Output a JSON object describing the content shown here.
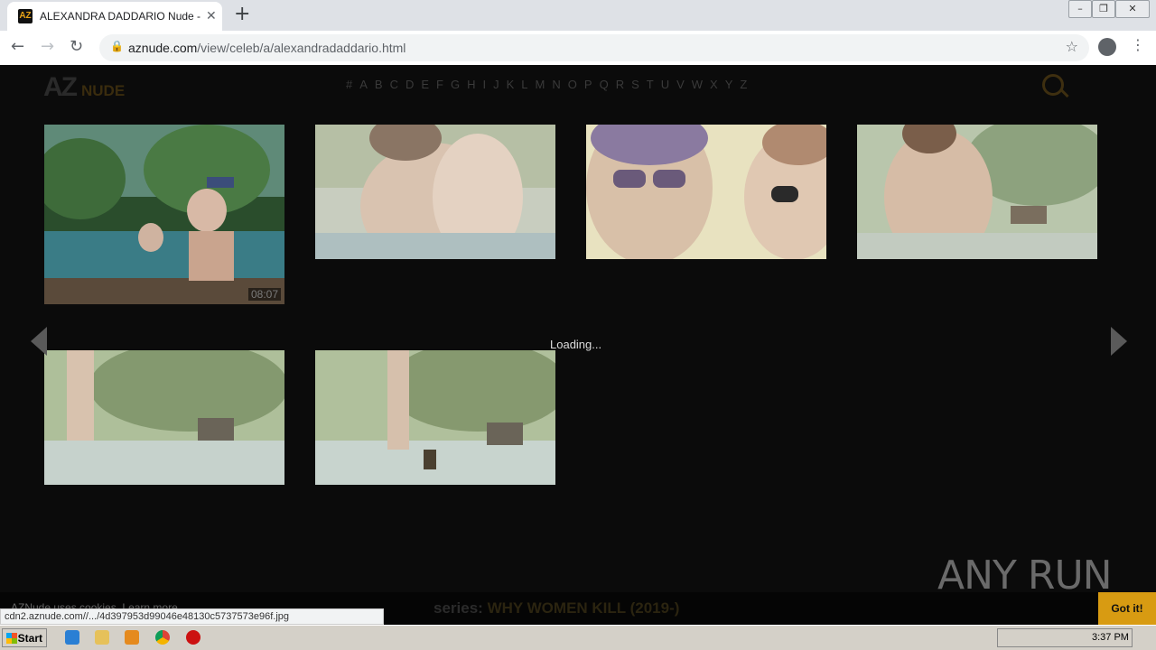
{
  "browser": {
    "tab_title": "ALEXANDRA DADDARIO Nude - AZNude",
    "tab_icon_text": "AZ",
    "url_host": "aznude.com",
    "url_path": "/view/celeb/a/alexandradaddario.html",
    "status_url": "cdn2.aznude.com//.../4d397953d99046e48130c5737573e96f.jpg"
  },
  "site": {
    "logo_az": "AZ",
    "logo_nude": "NUDE",
    "letters": [
      "#",
      "A",
      "B",
      "C",
      "D",
      "E",
      "F",
      "G",
      "H",
      "I",
      "J",
      "K",
      "L",
      "M",
      "N",
      "O",
      "P",
      "Q",
      "R",
      "S",
      "T",
      "U",
      "V",
      "W",
      "X",
      "Y",
      "Z"
    ]
  },
  "gallery": {
    "duration": "08:07",
    "loading": "Loading..."
  },
  "cookie": {
    "text": "AZNude uses cookies. Learn more",
    "button": "Got it!"
  },
  "series": {
    "label": "series:",
    "name": "WHY WOMEN KILL (2019-)"
  },
  "watermark": "ANY RUN",
  "taskbar": {
    "start": "Start",
    "time": "3:37 PM"
  },
  "colors": {
    "accent": "#d89b12",
    "page_bg": "#0b0b0b"
  }
}
